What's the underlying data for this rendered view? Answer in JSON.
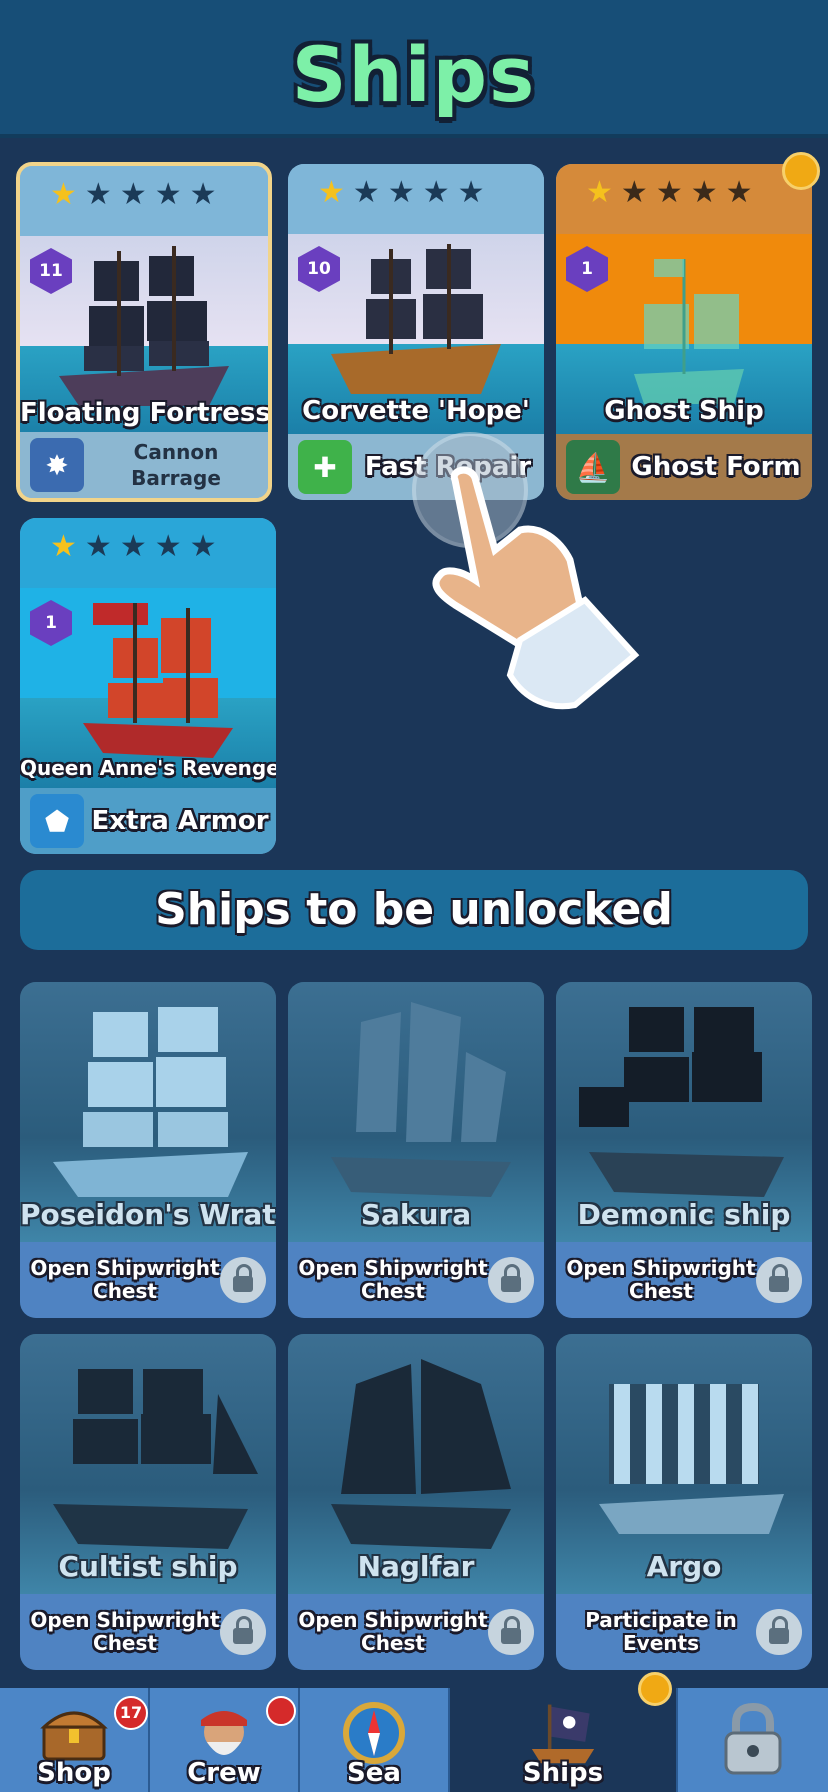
{
  "header": {
    "title": "Ships"
  },
  "owned_ships": [
    {
      "name": "Floating Fortress",
      "level": "11",
      "stars": 1,
      "ability": "Cannon Barrage",
      "ability_line1": "Cannon",
      "ability_line2": "Barrage",
      "selected": true
    },
    {
      "name": "Corvette 'Hope'",
      "level": "10",
      "stars": 1,
      "ability": "Fast Repair",
      "selected": false
    },
    {
      "name": "Ghost Ship",
      "level": "1",
      "stars": 1,
      "ability": "Ghost Form",
      "selected": false,
      "has_notification": true
    },
    {
      "name": "Queen Anne's Revenge",
      "level": "1",
      "stars": 1,
      "ability": "Extra Armor",
      "selected": false
    }
  ],
  "unlock_section": {
    "title": "Ships to be unlocked"
  },
  "locked_ships": [
    {
      "name": "Poseidon's Wrath",
      "req_line1": "Open Shipwright",
      "req_line2": "Chest"
    },
    {
      "name": "Sakura",
      "req_line1": "Open Shipwright",
      "req_line2": "Chest"
    },
    {
      "name": "Demonic ship",
      "req_line1": "Open Shipwright",
      "req_line2": "Chest"
    },
    {
      "name": "Cultist ship",
      "req_line1": "Open Shipwright",
      "req_line2": "Chest"
    },
    {
      "name": "Naglfar",
      "req_line1": "Open Shipwright",
      "req_line2": "Chest"
    },
    {
      "name": "Argo",
      "req_line1": "Participate in",
      "req_line2": "Events"
    }
  ],
  "tabs": [
    {
      "label": "Shop",
      "badge": "17",
      "icon": "treasure-chest-icon"
    },
    {
      "label": "Crew",
      "icon": "pirate-captain-icon",
      "has_notification": true
    },
    {
      "label": "Sea",
      "icon": "compass-icon"
    },
    {
      "label": "Ships",
      "icon": "ship-flag-icon",
      "active": true,
      "has_notification": true
    },
    {
      "label": "",
      "icon": "padlock-icon"
    }
  ],
  "colors": {
    "background": "#1b3658",
    "header_title": "#7df0a8",
    "star_on": "#f5c11d",
    "level_badge": "#6a3fbf",
    "notification": "#f0a914",
    "tab_badge": "#d52a2a"
  }
}
